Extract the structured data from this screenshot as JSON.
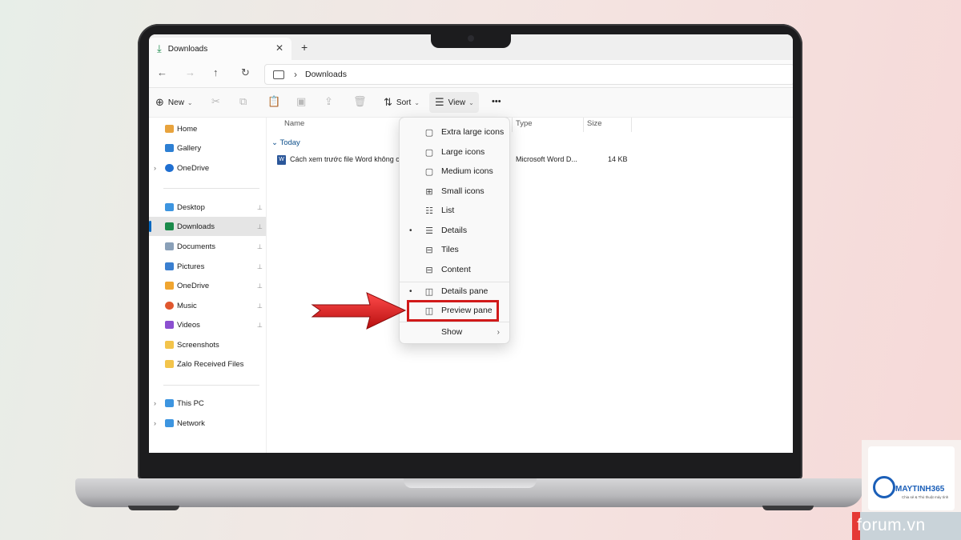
{
  "tab": {
    "title": "Downloads",
    "close": "✕",
    "new": "+"
  },
  "nav": {
    "back": "←",
    "forward": "→",
    "up": "↑",
    "refresh": "↻",
    "separator": "›",
    "crumb": "Downloads"
  },
  "commands": {
    "new": "New",
    "sort": "Sort",
    "view": "View",
    "more": "•••",
    "dropdown": "⌄"
  },
  "sidebar": {
    "items": [
      {
        "label": "Home",
        "icon": "home-icon",
        "color": "#e8a33d"
      },
      {
        "label": "Gallery",
        "icon": "gallery-icon",
        "color": "#2d7fd3"
      },
      {
        "label": "OneDrive",
        "icon": "onedrive-icon",
        "color": "#1f6fd1"
      },
      {
        "label": "Desktop",
        "icon": "desktop-icon",
        "color": "#3d95e0"
      },
      {
        "label": "Downloads",
        "icon": "download-icon",
        "color": "#1a8a4a"
      },
      {
        "label": "Documents",
        "icon": "documents-icon",
        "color": "#8aa0b8"
      },
      {
        "label": "Pictures",
        "icon": "pictures-icon",
        "color": "#3a7fd0"
      },
      {
        "label": "OneDrive",
        "icon": "onedrive-icon",
        "color": "#f0a530"
      },
      {
        "label": "Music",
        "icon": "music-icon",
        "color": "#e0572e"
      },
      {
        "label": "Videos",
        "icon": "videos-icon",
        "color": "#8b4fd0"
      },
      {
        "label": "Screenshots",
        "icon": "folder-icon",
        "color": "#f3c44b"
      },
      {
        "label": "Zalo Received Files",
        "icon": "folder-icon",
        "color": "#f3c44b"
      },
      {
        "label": "This PC",
        "icon": "pc-icon",
        "color": "#3d95e0"
      },
      {
        "label": "Network",
        "icon": "network-icon",
        "color": "#3d95e0"
      }
    ],
    "expander": "›",
    "pin": "📌"
  },
  "columns": {
    "name": "Name",
    "type": "Type",
    "size": "Size"
  },
  "group": {
    "label": "Today",
    "chevron": "⌄"
  },
  "file": {
    "name": "Cách xem trước file Word không cà",
    "type": "Microsoft Word D...",
    "size": "14 KB",
    "icon_letter": "W"
  },
  "view_menu": {
    "items": [
      {
        "label": "Extra large icons",
        "icon": "▢",
        "checked": false
      },
      {
        "label": "Large icons",
        "icon": "▢",
        "checked": false
      },
      {
        "label": "Medium icons",
        "icon": "▢",
        "checked": false
      },
      {
        "label": "Small icons",
        "icon": "⊞",
        "checked": false
      },
      {
        "label": "List",
        "icon": "☷",
        "checked": false
      },
      {
        "label": "Details",
        "icon": "☰",
        "checked": true
      },
      {
        "label": "Tiles",
        "icon": "⊟",
        "checked": false
      },
      {
        "label": "Content",
        "icon": "⊟",
        "checked": false
      },
      {
        "label": "Details pane",
        "icon": "◫",
        "checked": true
      },
      {
        "label": "Preview pane",
        "icon": "◫",
        "checked": false
      },
      {
        "label": "Show",
        "icon": "",
        "checked": false
      }
    ],
    "bullet": "•",
    "submenu_arrow": "›"
  },
  "watermark": {
    "brand": "MAYTINH365",
    "tagline": "Chia sẻ & Thủ thuật máy tính",
    "forum": "forum.vn"
  },
  "colors": {
    "highlight": "#d11a1a",
    "selection": "#e5e5e5",
    "accent": "#0067c0"
  }
}
